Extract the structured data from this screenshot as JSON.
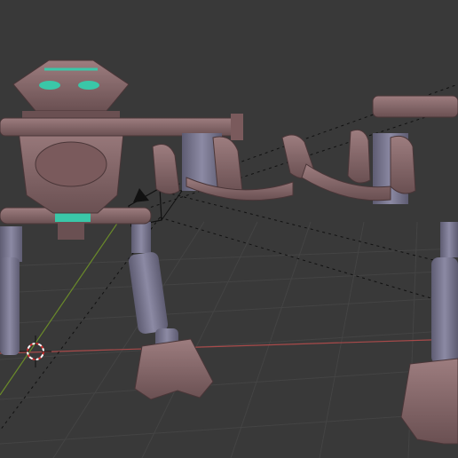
{
  "viewport": {
    "scene": "3d-viewport-robot-model",
    "colors": {
      "background": "#393939",
      "grid_line": "#444444",
      "x_axis": "#a84a4a",
      "y_axis": "#6a8a2a",
      "body_mauve": "#8a6a6c",
      "body_dark": "#5a4446",
      "joint_gray": "#7a7890",
      "accent_teal": "#3ac7a8"
    }
  }
}
